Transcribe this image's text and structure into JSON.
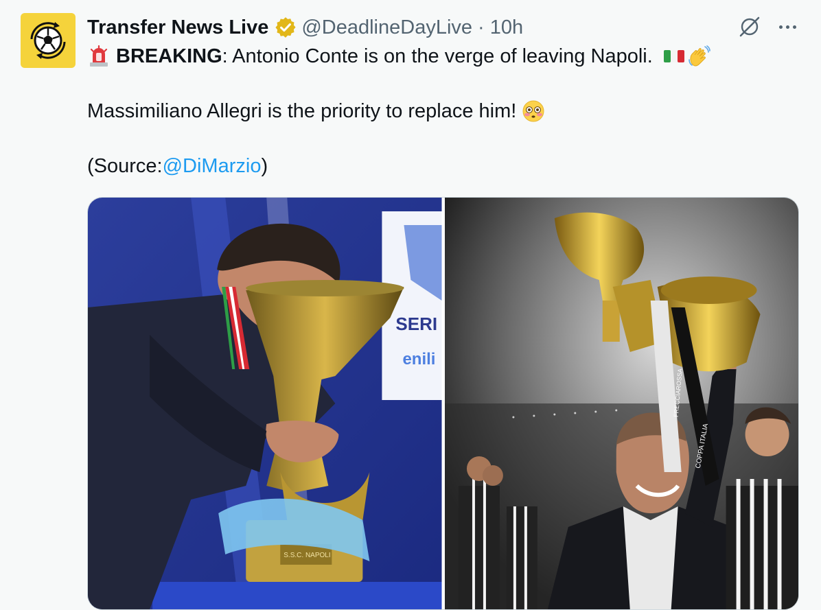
{
  "author": {
    "display_name": "Transfer News Live",
    "handle": "@DeadlineDayLive",
    "separator": "·",
    "time": "10h",
    "avatar_icon": "soccer-ball-icon",
    "verified_icon": "verified-gold-badge-icon"
  },
  "tweet": {
    "line1": {
      "emoji": "rotating-light-emoji",
      "bold": "BREAKING",
      "text": ": Antonio Conte is on the verge of leaving Napoli.",
      "trailing_emojis": [
        "italy-flag-emoji",
        "waving-hand-emoji"
      ]
    },
    "line2": {
      "text": "Massimiliano Allegri is the priority to replace him!",
      "emoji": "flushed-face-emoji"
    },
    "line3": {
      "prefix": "(Source: ",
      "mention": "@DiMarzio",
      "suffix": ")"
    }
  },
  "media": {
    "left_photo_text": {
      "brand1": "SERI",
      "brand2": "enili",
      "plaque": "S.S.C. NAPOLI"
    },
    "right_photo_text": {
      "ribbon1": "COPPA ITALIA",
      "ribbon2": "FRECCIAROSSA"
    }
  },
  "colors": {
    "accent": "#1d9bf0",
    "avatar_bg": "#f5d33b",
    "muted_text": "#536471",
    "badge_gold": "#e2b719"
  },
  "actions": {
    "grok_icon": "grok-icon",
    "more_icon": "more-options-icon"
  }
}
